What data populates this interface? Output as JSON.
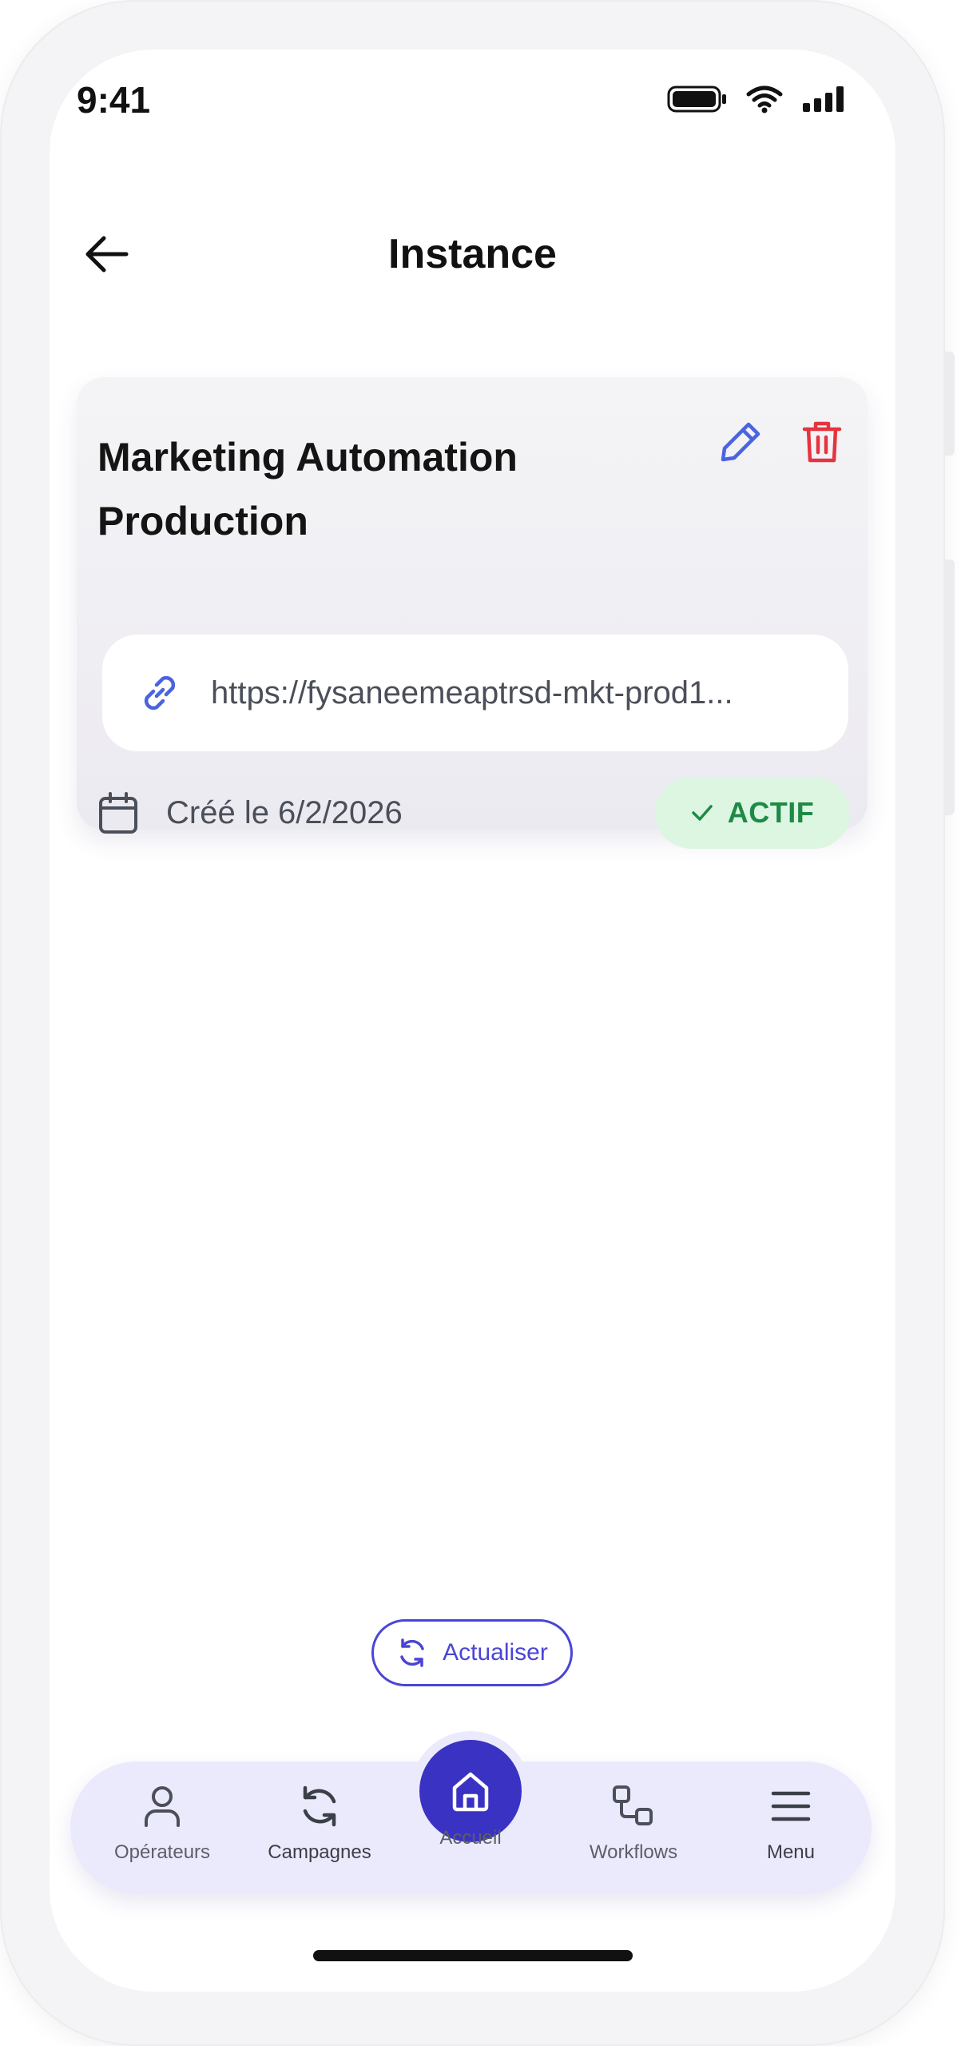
{
  "status_bar": {
    "time": "9:41"
  },
  "header": {
    "title": "Instance"
  },
  "instance": {
    "title": "Marketing Automation Production",
    "url": "https://fysaneemeaptrsd-mkt-prod1...",
    "created": "Créé le 6/2/2026",
    "status": "ACTIF"
  },
  "refresh": {
    "label": "Actualiser"
  },
  "bottom_nav": {
    "items": [
      {
        "label": "Opérateurs",
        "icon": "user-icon"
      },
      {
        "label": "Campagnes",
        "icon": "refresh-icon"
      },
      {
        "label": "Accueil",
        "icon": "home-icon"
      },
      {
        "label": "Workflows",
        "icon": "workflow-icon"
      },
      {
        "label": "Menu",
        "icon": "hamburger-icon"
      }
    ]
  },
  "colors": {
    "accent": "#3a32c2",
    "edit": "#4a63e0",
    "delete": "#e5343f",
    "badge_bg": "#dcf6e2",
    "badge_text": "#1e8a46",
    "nav_bg": "#ebeafc"
  }
}
